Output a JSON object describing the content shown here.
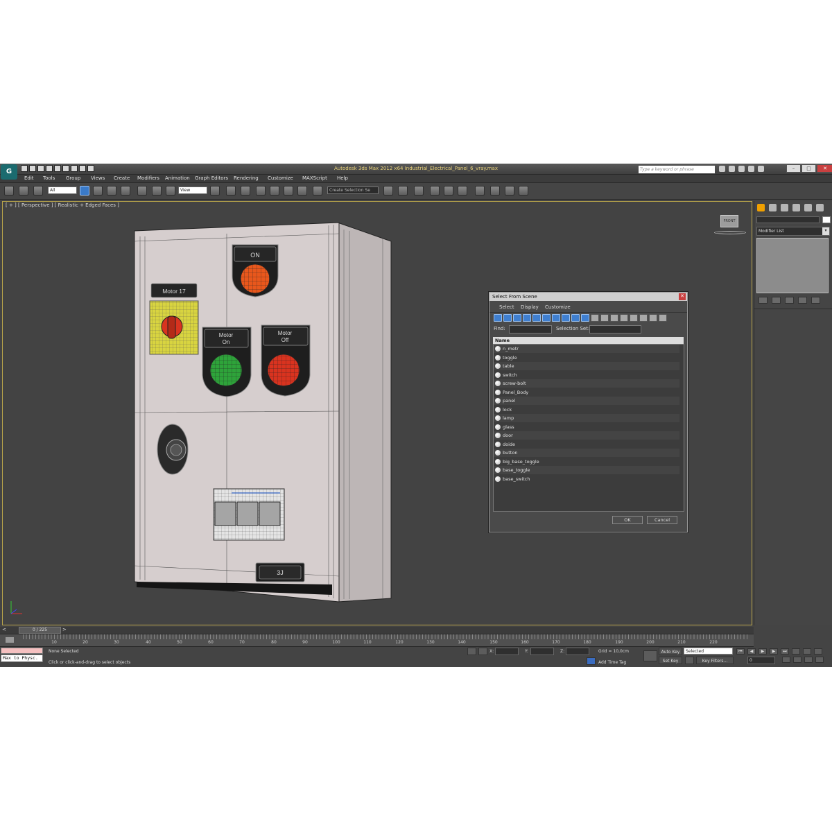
{
  "app": {
    "title": "Autodesk 3ds Max 2012 x64    Industrial_Electrical_Panel_6_vray.max",
    "search_placeholder": "Type a keyword or phrase",
    "logo": "3ds-max-logo",
    "window_buttons": {
      "minimize": "–",
      "maximize": "□",
      "close": "✕"
    }
  },
  "menu": [
    "Edit",
    "Tools",
    "Group",
    "Views",
    "Create",
    "Modifiers",
    "Animation",
    "Graph Editors",
    "Rendering",
    "Customize",
    "MAXScript",
    "Help"
  ],
  "toolbar": {
    "selection_filter": "All",
    "reference_coord": "View",
    "named_selection_placeholder": "Create Selection Se",
    "snap_labels": [
      "3",
      "%"
    ]
  },
  "viewport": {
    "label": "[ + ] [ Perspective ] [ Realistic + Edged Faces ]",
    "viewcube_label": "FRONT",
    "panel": {
      "motor_label": "Motor 17",
      "on_label": "ON",
      "motor_on_label": [
        "Motor",
        "On"
      ],
      "motor_off_label": [
        "Motor",
        "Off"
      ],
      "plate_label": "3J",
      "colors": {
        "body": "#d6cece",
        "red": "#d9331f",
        "orange": "#e8571c",
        "green": "#2ea33a",
        "yellow": "#d8d440",
        "bezel": "#1e1e1e"
      }
    }
  },
  "command_panel": {
    "modifier_list": "Modifier List",
    "active_tab_color": "#f0a000"
  },
  "select_dialog": {
    "title": "Select From Scene",
    "menu": [
      "Select",
      "Display",
      "Customize"
    ],
    "find_label": "Find:",
    "selection_set_label": "Selection Set:",
    "column_header": "Name",
    "objects": [
      "n_metr",
      "toggle",
      "table",
      "switch",
      "screw-bolt",
      "Panel_Body",
      "panel",
      "lock",
      "lamp",
      "glass",
      "door",
      "doide",
      "button",
      "big_base_toggle",
      "base_toggle",
      "base_switch"
    ],
    "ok": "OK",
    "cancel": "Cancel"
  },
  "timeline": {
    "slider_label": "0 / 225",
    "prev": "<",
    "next": ">",
    "ruler_labels": [
      "10",
      "20",
      "30",
      "40",
      "50",
      "60",
      "70",
      "80",
      "90",
      "100",
      "110",
      "120",
      "130",
      "140",
      "150",
      "160",
      "170",
      "180",
      "190",
      "200",
      "210",
      "220"
    ]
  },
  "status": {
    "maxscript_listener": "Max to Physc.",
    "selection": "None Selected",
    "prompt": "Click or click-and-drag to select objects",
    "x_label": "X:",
    "y_label": "Y:",
    "z_label": "Z:",
    "grid": "Grid = 10,0cm",
    "add_time_tag": "Add Time Tag",
    "auto_key": "Auto Key",
    "set_key": "Set Key",
    "key_mode": "Selected",
    "key_filters": "Key Filters...",
    "current_frame": "0"
  }
}
